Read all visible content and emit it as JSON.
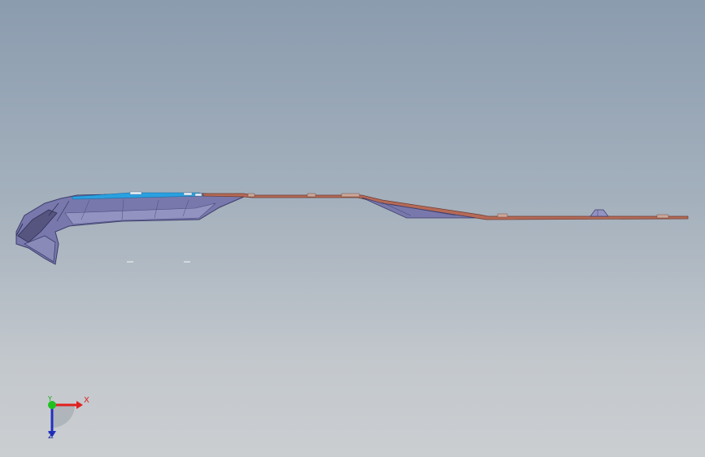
{
  "window": {
    "background_top": "#8b9caf",
    "background_bottom": "#cbced1"
  },
  "model": {
    "icon": "sheet-metal-part",
    "colors": {
      "shell": "#6f6fa6",
      "shell_dark": "#4a4a7a",
      "trim": "#b56a57",
      "trim_dark": "#7a3f33",
      "highlight": "#2aa0e0"
    }
  },
  "triad": {
    "x_label": "X",
    "y_label": "Y",
    "z_label": "Z",
    "x_color": "#e02020",
    "y_color": "#20c020",
    "z_color": "#2030c0"
  }
}
